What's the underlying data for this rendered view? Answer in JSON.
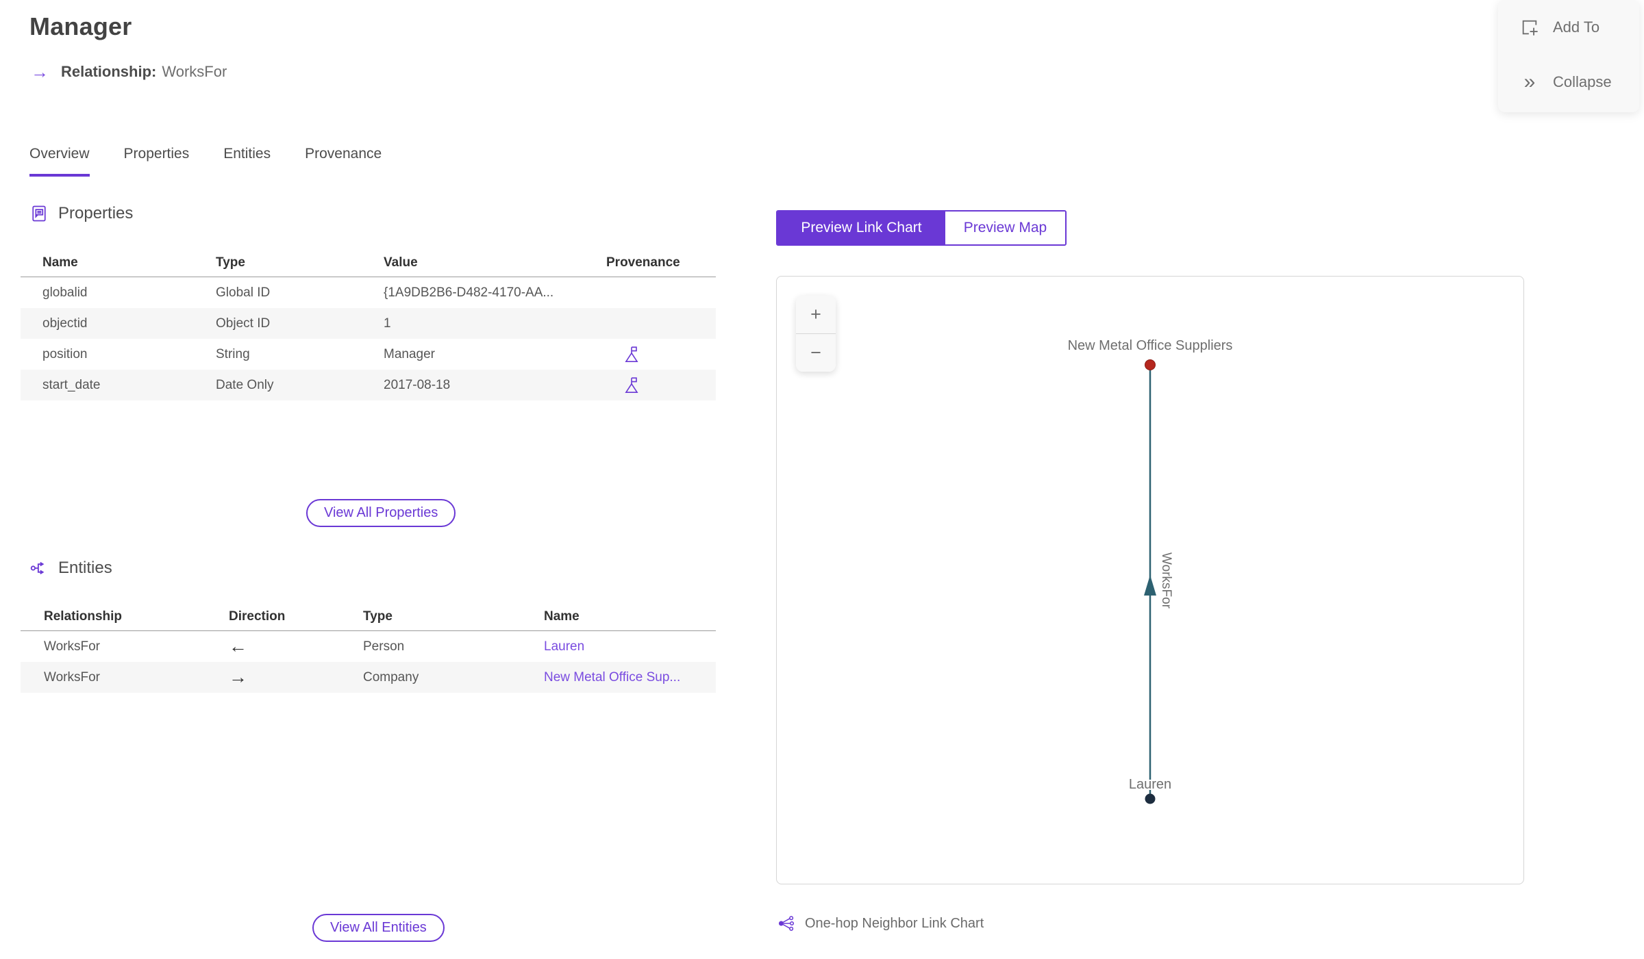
{
  "header": {
    "title": "Manager",
    "relationship_label": "Relationship:",
    "relationship_value": "WorksFor",
    "relationship_arrow": "→"
  },
  "actions": {
    "add_to": "Add To",
    "collapse": "Collapse",
    "collapse_glyph": "»"
  },
  "tabs": {
    "overview": "Overview",
    "properties": "Properties",
    "entities": "Entities",
    "provenance": "Provenance"
  },
  "properties": {
    "title": "Properties",
    "headers": {
      "name": "Name",
      "type": "Type",
      "value": "Value",
      "provenance": "Provenance"
    },
    "rows": [
      {
        "name": "globalid",
        "type": "Global ID",
        "value": "{1A9DB2B6-D482-4170-AA...",
        "has_provenance": false
      },
      {
        "name": "objectid",
        "type": "Object ID",
        "value": "1",
        "has_provenance": false
      },
      {
        "name": "position",
        "type": "String",
        "value": "Manager",
        "has_provenance": true
      },
      {
        "name": "start_date",
        "type": "Date Only",
        "value": "2017-08-18",
        "has_provenance": true
      }
    ],
    "view_all": "View All Properties"
  },
  "entities": {
    "title": "Entities",
    "headers": {
      "relationship": "Relationship",
      "direction": "Direction",
      "type": "Type",
      "name": "Name"
    },
    "rows": [
      {
        "relationship": "WorksFor",
        "direction": "←",
        "type": "Person",
        "name": "Lauren"
      },
      {
        "relationship": "WorksFor",
        "direction": "→",
        "type": "Company",
        "name": "New Metal Office Sup..."
      }
    ],
    "view_all": "View All Entities"
  },
  "preview": {
    "link_chart_tab": "Preview Link Chart",
    "map_tab": "Preview Map",
    "zoom_in": "+",
    "zoom_out": "−",
    "caption": "One-hop Neighbor Link Chart"
  },
  "chart_data": {
    "type": "link-chart",
    "nodes": [
      {
        "label": "New Metal Office Suppliers",
        "color": "#b5271e",
        "position": "top"
      },
      {
        "label": "Lauren",
        "color": "#1d2d3f",
        "position": "bottom"
      }
    ],
    "edges": [
      {
        "label": "WorksFor",
        "source": "Lauren",
        "target": "New Metal Office Suppliers",
        "direction": "up",
        "color": "#2d6171"
      }
    ]
  },
  "colors": {
    "accent": "#6a38d5",
    "link": "#7a4ce0",
    "edge": "#2d6171",
    "node_red": "#b5271e",
    "node_navy": "#1d2d3f"
  }
}
